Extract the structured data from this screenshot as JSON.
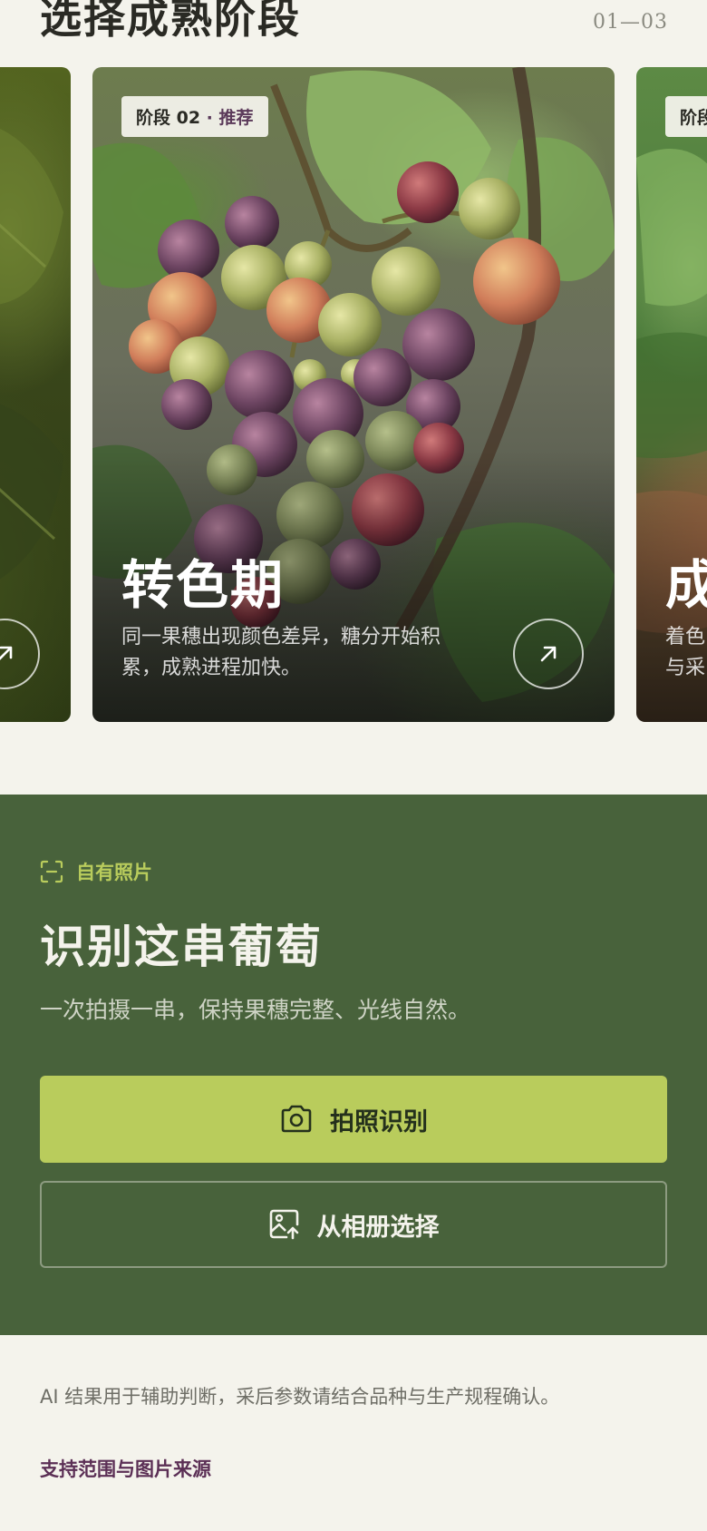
{
  "header": {
    "title": "选择成熟阶段",
    "counter": "01—03"
  },
  "cards": [
    {
      "id": "left",
      "arrow_icon": "arrow-up-right-icon"
    },
    {
      "id": "main",
      "badge_stage": "阶段 02",
      "badge_sep": " · ",
      "badge_tag": "推荐",
      "title": "转色期",
      "description": "同一果穗出现颜色差异，糖分开始积累，成熟进程加快。",
      "arrow_icon": "arrow-up-right-icon"
    },
    {
      "id": "right",
      "badge_stage": "阶段",
      "title": "成",
      "description_line1": "着色",
      "description_line2": "与采"
    }
  ],
  "identify": {
    "eyebrow": "自有照片",
    "eyebrow_icon": "scan-frame-icon",
    "title": "识别这串葡萄",
    "subtitle": "一次拍摄一串，保持果穗完整、光线自然。",
    "primary_button": "拍照识别",
    "primary_icon": "camera-icon",
    "secondary_button": "从相册选择",
    "secondary_icon": "image-upload-icon",
    "colors": {
      "background": "#48623b",
      "accent": "#b9cc5c"
    }
  },
  "footer": {
    "disclaimer": "AI 结果用于辅助判断，采后参数请结合品种与生产规程确认。",
    "support_link": "支持范围与图片来源"
  }
}
